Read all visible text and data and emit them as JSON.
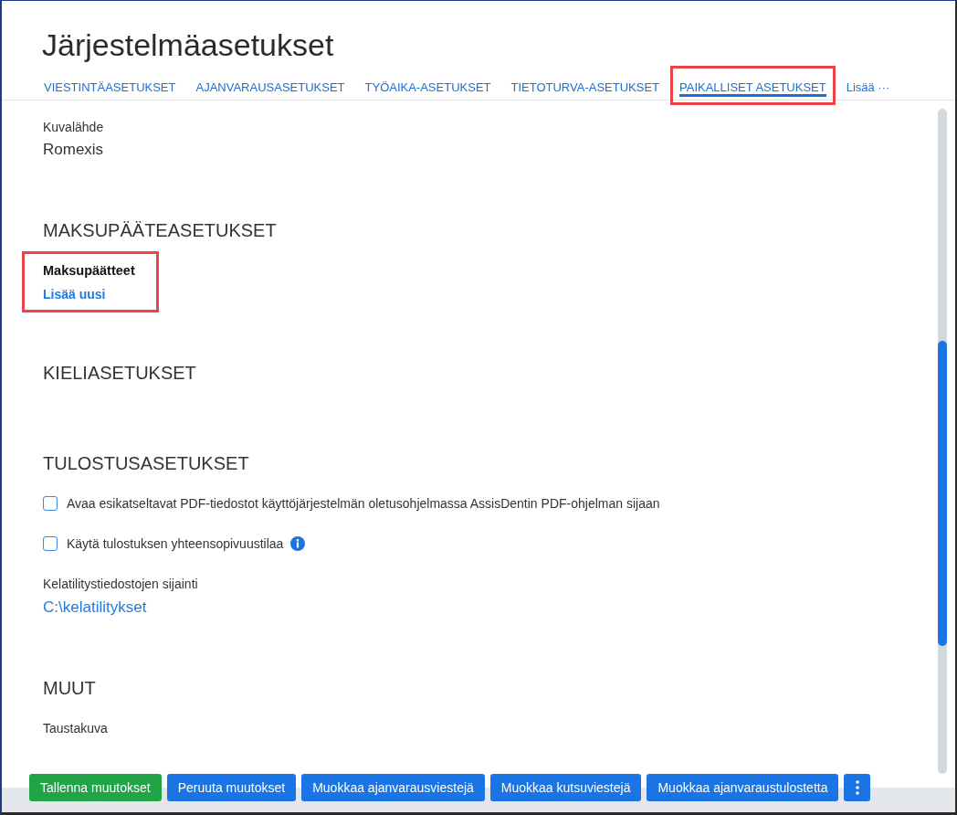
{
  "window": {
    "title": "Järjestelmäasetukset"
  },
  "tabs": [
    {
      "label": "VIESTINTÄASETUKSET",
      "selected": false,
      "highlighted": false
    },
    {
      "label": "AJANVARAUSASETUKSET",
      "selected": false,
      "highlighted": false
    },
    {
      "label": "TYÖAIKA-ASETUKSET",
      "selected": false,
      "highlighted": false
    },
    {
      "label": "TIETOTURVA-ASETUKSET",
      "selected": false,
      "highlighted": false
    },
    {
      "label": "PAIKALLISET ASETUKSET",
      "selected": true,
      "highlighted": true
    }
  ],
  "more_tabs": {
    "label": "Lisää ···"
  },
  "sections": [
    {
      "fields": [
        {
          "kind": "value",
          "label": "Kuvalähde",
          "value": "Romexis",
          "highlighted": false
        }
      ]
    },
    {
      "heading": "MAKSUPÄÄTEASETUKSET",
      "fields": [
        {
          "kind": "list",
          "label": "Maksupäätteet",
          "link": "Lisää uusi",
          "highlighted": true
        }
      ]
    },
    {
      "heading": "KIELIASETUKSET"
    },
    {
      "heading": "TULOSTUSASETUKSET",
      "fields": [
        {
          "kind": "checkbox",
          "label": "Avaa esikatseltavat PDF-tiedostot käyttöjärjestelmän oletusohjelmassa AssisDentin PDF-ohjelman sijaan",
          "checked": false,
          "info": false,
          "highlighted": false
        },
        {
          "kind": "checkbox",
          "label": "Käytä tulostuksen yhteensopivuustilaa",
          "checked": false,
          "info": true,
          "highlighted": false
        },
        {
          "kind": "path",
          "label": "Kelatilitystiedostojen sijainti",
          "value": "C:\\kelatilitykset",
          "highlighted": false
        }
      ]
    },
    {
      "heading": "MUUT",
      "fields": [
        {
          "kind": "label",
          "label": "Taustakuva",
          "highlighted": false
        }
      ]
    }
  ],
  "buttons": [
    {
      "kind": "success",
      "label": "Tallenna muutokset"
    },
    {
      "kind": "primary",
      "label": "Peruuta muutokset"
    },
    {
      "kind": "primary",
      "label": "Muokkaa ajanvarausviestejä"
    },
    {
      "kind": "primary",
      "label": "Muokkaa kutsuviestejä"
    },
    {
      "kind": "primary",
      "label": "Muokkaa ajanvaraustulostetta"
    },
    {
      "kind": "menu"
    }
  ]
}
